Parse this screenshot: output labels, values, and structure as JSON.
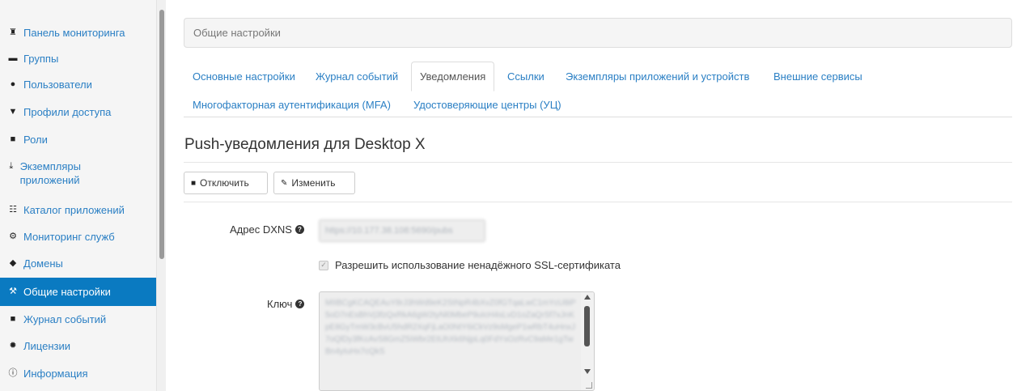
{
  "sidebar": {
    "items": [
      {
        "label": "Панель мониторинга",
        "icon": "home-icon",
        "glyph": "⌂"
      },
      {
        "label": "Группы",
        "icon": "groups-icon",
        "glyph": "▮"
      },
      {
        "label": "Пользователи",
        "icon": "user-icon",
        "glyph": "●"
      },
      {
        "label": "Профили доступа",
        "icon": "filter-icon",
        "glyph": "▼"
      },
      {
        "label": "Роли",
        "icon": "lock-icon",
        "glyph": "■"
      },
      {
        "label": "Экземпляры приложений",
        "icon": "download-icon",
        "glyph": "⤓"
      },
      {
        "label": "Каталог приложений",
        "icon": "grid-icon",
        "glyph": "☷"
      },
      {
        "label": "Мониторинг служб",
        "icon": "gear-icon",
        "glyph": "⚙"
      },
      {
        "label": "Домены",
        "icon": "tags-icon",
        "glyph": "◆"
      },
      {
        "label": "Общие настройки",
        "icon": "wrench-icon",
        "glyph": "⚒",
        "active": true
      },
      {
        "label": "Журнал событий",
        "icon": "book-icon",
        "glyph": "■"
      },
      {
        "label": "Лицензии",
        "icon": "certificate-icon",
        "glyph": "✹"
      },
      {
        "label": "Информация",
        "icon": "info-icon",
        "glyph": "ⓘ"
      }
    ]
  },
  "breadcrumb": {
    "label": "Общие настройки"
  },
  "tabs": [
    {
      "label": "Основные настройки"
    },
    {
      "label": "Журнал событий"
    },
    {
      "label": "Уведомления",
      "active": true
    },
    {
      "label": "Ссылки"
    },
    {
      "label": "Экземпляры приложений и устройств"
    },
    {
      "label": "Внешние сервисы"
    },
    {
      "label": "Многофакторная аутентификация (MFA)"
    },
    {
      "label": "Удостоверяющие центры (УЦ)"
    }
  ],
  "section": {
    "title": "Push-уведомления для Desktop X"
  },
  "toolbar": {
    "disable_label": "Отключить",
    "edit_label": "Изменить"
  },
  "form": {
    "dxns_label": "Адрес DXNS",
    "dxns_value": "https://10.177.38.108:5690/pubs",
    "ssl_checkbox_label": "Разрешить использование ненадёжного SSL-сертификата",
    "ssl_checked": true,
    "key_label": "Ключ",
    "key_value": "MIIBCgKCAQEAuY8rJ3hWd9eK2StNpR4bXvZ0fGTqaLwC1mYcU8iP5oD7nEsBhVj3fzQxRkA6gW2tyNl0MbeP9uIcH4sLvD1oZaQrSf7xJnKpE8GyTmW3cBvU5hdR2XqFjLaO0NtY6iCkVz9sMgeP1wRbT4uHnxJ7oQlDy3fKcAvS8GmZ5iWbr2EtUhXk6NjpLq0FdYsOzRvC9aMe1gTwBn4yIuHx7cQkS"
  },
  "colors": {
    "link": "#2a7fc4",
    "active_nav": "#0a7ac1",
    "sidebar_bg": "#f5f5f5"
  }
}
